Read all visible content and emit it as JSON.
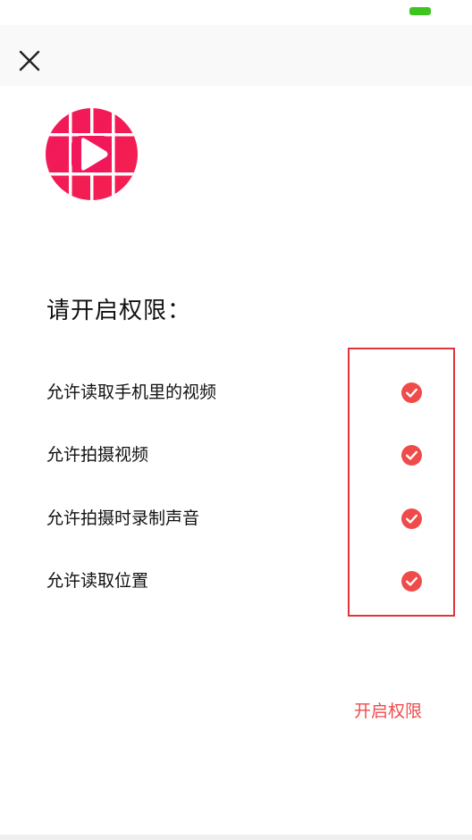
{
  "status_bar": {
    "battery_color": "#3cc51f"
  },
  "header": {
    "close_icon": "close-icon"
  },
  "app": {
    "logo_icon": "video-play-logo",
    "brand_color": "#f0185a"
  },
  "title": "请开启权限：",
  "permissions": [
    {
      "label": "允许读取手机里的视频",
      "checked": true
    },
    {
      "label": "允许拍摄视频",
      "checked": true
    },
    {
      "label": "允许拍摄时录制声音",
      "checked": true
    },
    {
      "label": "允许读取位置",
      "checked": true
    }
  ],
  "check_icon": "check-circle-icon",
  "check_color": "#f04b4b",
  "highlight_color": "#e0333b",
  "action": {
    "enable_label": "开启权限",
    "color": "#f04b4b"
  }
}
